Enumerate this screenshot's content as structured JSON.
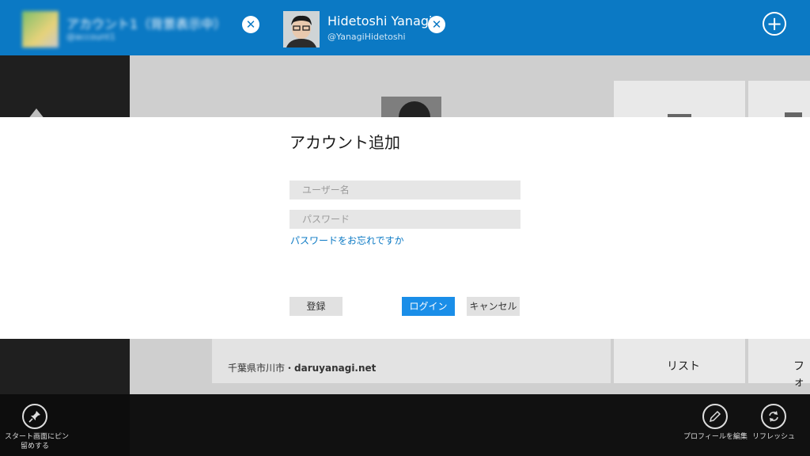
{
  "accounts": [
    {
      "name": "アカウント1（背景表示中）",
      "handle": "@account1"
    },
    {
      "name": "Hidetoshi Yanagi",
      "handle": "@YanagiHidetoshi"
    }
  ],
  "background": {
    "location_prefix": "千葉県市川市・",
    "location_site": "daruyanagi.net",
    "tile_list": "リスト",
    "tile_photo": "フォ"
  },
  "dialog": {
    "title": "アカウント追加",
    "username_placeholder": "ユーザー名",
    "password_placeholder": "パスワード",
    "forgot": "パスワードをお忘れですか",
    "register": "登録",
    "login": "ログイン",
    "cancel": "キャンセル"
  },
  "appbar": {
    "pin_label_1": "スタート画面にピン",
    "pin_label_2": "留めする",
    "edit_profile": "プロフィールを編集",
    "refresh": "リフレッシュ"
  },
  "colors": {
    "accent": "#0b79c4",
    "login_button": "#1a8ee8"
  }
}
